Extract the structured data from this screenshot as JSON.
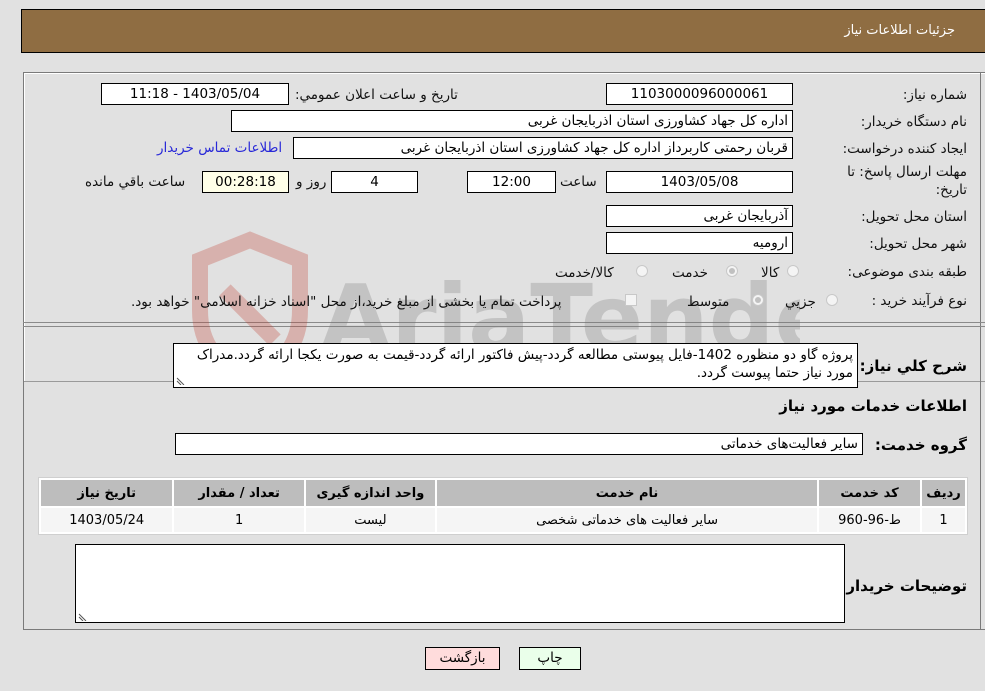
{
  "header": {
    "title": "جزئیات اطلاعات نیاز"
  },
  "form": {
    "need_number": {
      "label": "شماره نیاز:",
      "value": "1103000096000061"
    },
    "announce_datetime": {
      "label": "تاریخ و ساعت اعلان عمومي:",
      "value": "1403/05/04 - 11:18"
    },
    "buyer_org": {
      "label": "نام دستگاه خریدار:",
      "value": "اداره کل جهاد کشاورزی استان اذربایجان غربی"
    },
    "requester": {
      "label": "ایجاد کننده درخواست:",
      "value": "قربان  رحمتی  کاربرداز اداره کل جهاد کشاورزی استان اذربایجان غربی"
    },
    "buyer_contact_link": "اطلاعات تماس خریدار",
    "deadline": {
      "label_line1": "مهلت ارسال پاسخ: تا",
      "label_line2": "تاریخ:",
      "date": "1403/05/08",
      "time_label": "ساعت",
      "time": "12:00",
      "days": "4",
      "days_label": "روز و",
      "remaining": "00:28:18",
      "remaining_label": "ساعت باقي مانده"
    },
    "delivery_province": {
      "label": "استان محل تحویل:",
      "value": "آذربایجان غربی"
    },
    "delivery_city": {
      "label": "شهر محل تحویل:",
      "value": "ارومیه"
    },
    "category": {
      "label": "طبقه بندی موضوعی:",
      "options": [
        "کالا",
        "خدمت",
        "کالا/خدمت"
      ],
      "selected": "خدمت"
    },
    "purchase_process": {
      "label": "نوع فرآیند خرید :",
      "options": [
        "جزيي",
        "متوسط"
      ],
      "selected": "متوسط",
      "treasury_note": "پرداخت تمام یا بخشی از مبلغ خرید،از محل \"اسناد خزانه اسلامی\" خواهد بود."
    }
  },
  "description": {
    "label": "شرح كلي نياز:",
    "value": "پروژه گاو دو منظوره 1402-فایل پیوستی مطالعه گردد-پیش فاکتور ارائه گردد-قیمت به صورت یکجا ارائه گردد.مدراک مورد نیاز حتما پیوست گردد."
  },
  "services_section": {
    "title": "اطلاعات خدمات مورد نیاز",
    "group_label": "گروه خدمت:",
    "group_value": "سایر فعالیت‌های خدماتی",
    "table": {
      "headers": [
        "ردیف",
        "کد خدمت",
        "نام خدمت",
        "واحد اندازه گیری",
        "تعداد / مقدار",
        "تاریخ نیاز"
      ],
      "rows": [
        [
          "1",
          "ط-96-960",
          "سایر فعالیت های خدماتی شخصی",
          "لیست",
          "1",
          "1403/05/24"
        ]
      ]
    }
  },
  "buyer_notes": {
    "label": "توضیحات خریدار:",
    "value": ""
  },
  "buttons": {
    "print": "چاپ",
    "back": "بازگشت"
  },
  "watermark": {
    "text": "AriaTender.neT"
  }
}
